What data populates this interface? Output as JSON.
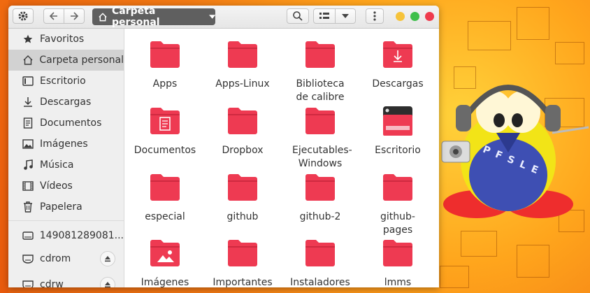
{
  "colors": {
    "folder": "#ee3a52",
    "folder_dark": "#cf2a40",
    "selected": "#d2d2d2"
  },
  "toolbar": {
    "settings_icon": "gear-icon",
    "back_icon": "arrow-left-icon",
    "forward_icon": "arrow-right-icon",
    "path_label": "Carpeta personal",
    "search_icon": "search-icon",
    "view_icon": "view-columns-icon",
    "menu_icon": "kebab-menu-icon"
  },
  "sidebar": {
    "items": [
      {
        "label": "Favoritos",
        "icon": "star-icon"
      },
      {
        "label": "Carpeta personal",
        "icon": "home-icon"
      },
      {
        "label": "Escritorio",
        "icon": "desktop-icon"
      },
      {
        "label": "Descargas",
        "icon": "download-icon"
      },
      {
        "label": "Documentos",
        "icon": "document-icon"
      },
      {
        "label": "Imágenes",
        "icon": "image-icon"
      },
      {
        "label": "Música",
        "icon": "music-icon"
      },
      {
        "label": "Vídeos",
        "icon": "film-icon"
      },
      {
        "label": "Papelera",
        "icon": "trash-icon"
      },
      {
        "label": "149081289081...",
        "icon": "drive-icon"
      },
      {
        "label": "cdrom",
        "icon": "optical-drive-icon"
      },
      {
        "label": "cdrw",
        "icon": "optical-drive-icon"
      }
    ]
  },
  "files": [
    {
      "name": "Apps",
      "type": "folder"
    },
    {
      "name": "Apps-Linux",
      "type": "folder"
    },
    {
      "name": "Biblioteca de calibre",
      "type": "folder"
    },
    {
      "name": "Descargas",
      "type": "download-folder"
    },
    {
      "name": "Documentos",
      "type": "document-folder"
    },
    {
      "name": "Dropbox",
      "type": "folder"
    },
    {
      "name": "Ejecutables-Windows",
      "type": "folder"
    },
    {
      "name": "Escritorio",
      "type": "desktop-folder"
    },
    {
      "name": "especial",
      "type": "folder"
    },
    {
      "name": "github",
      "type": "folder"
    },
    {
      "name": "github-2",
      "type": "folder"
    },
    {
      "name": "github-pages",
      "type": "folder"
    },
    {
      "name": "Imágenes",
      "type": "image-folder"
    },
    {
      "name": "Importantes",
      "type": "folder"
    },
    {
      "name": "Instaladores Linux",
      "type": "folder"
    },
    {
      "name": "lmms",
      "type": "folder"
    }
  ],
  "wallpaper": {
    "mascot_letters": "P F S L E"
  }
}
